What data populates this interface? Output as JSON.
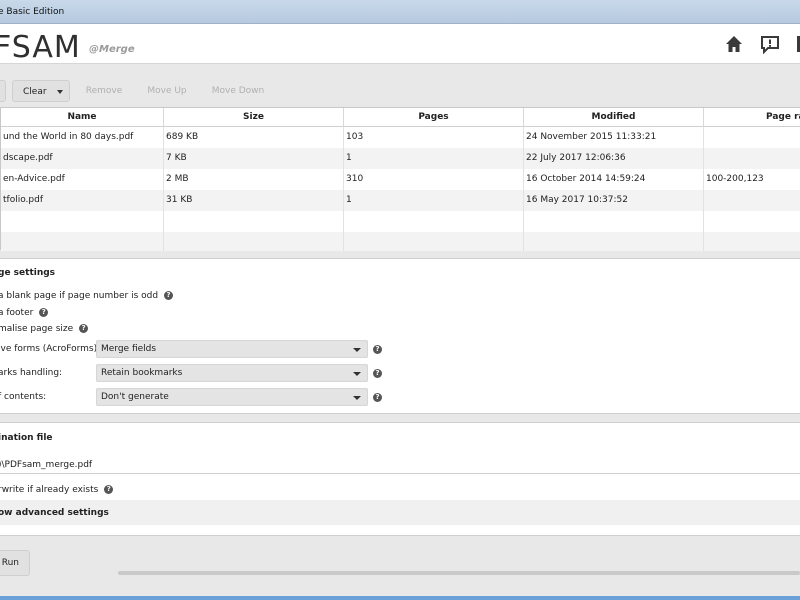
{
  "window": {
    "title": "e Basic Edition"
  },
  "header": {
    "logo": "FSAM",
    "module": "@Merge",
    "icons": [
      "home-icon",
      "notification-icon"
    ]
  },
  "toolbar": {
    "clear": "Clear",
    "remove": "Remove",
    "move_up": "Move Up",
    "move_down": "Move Down"
  },
  "table": {
    "columns": [
      "Name",
      "Size",
      "Pages",
      "Modified",
      "Page ra"
    ],
    "rows": [
      {
        "name": "und the World in 80 days.pdf",
        "size": "689 KB",
        "pages": "103",
        "modified": "24 November 2015 11:33:21",
        "range": ""
      },
      {
        "name": "dscape.pdf",
        "size": "7 KB",
        "pages": "1",
        "modified": "22 July 2017 12:06:36",
        "range": ""
      },
      {
        "name": "en-Advice.pdf",
        "size": "2 MB",
        "pages": "310",
        "modified": "16 October 2014 14:59:24",
        "range": "100-200,123"
      },
      {
        "name": "tfolio.pdf",
        "size": "31 KB",
        "pages": "1",
        "modified": "16 May 2017 10:37:52",
        "range": ""
      }
    ]
  },
  "merge_settings": {
    "title": "ge settings",
    "blank_page": "a blank page if page number is odd",
    "footer": "a footer",
    "normalise": "malise page size",
    "forms_label": "ive forms (AcroForms):",
    "forms_value": "Merge fields",
    "bookmarks_label": "arks handling:",
    "bookmarks_value": "Retain bookmarks",
    "toc_label": "f contents:",
    "toc_value": "Don't generate"
  },
  "destination": {
    "title": "ination file",
    "path": ")\\PDFsam_merge.pdf",
    "overwrite": "rwrite if already exists",
    "advanced": "ow advanced settings"
  },
  "run": {
    "label": "Run"
  },
  "help_glyph": "?"
}
